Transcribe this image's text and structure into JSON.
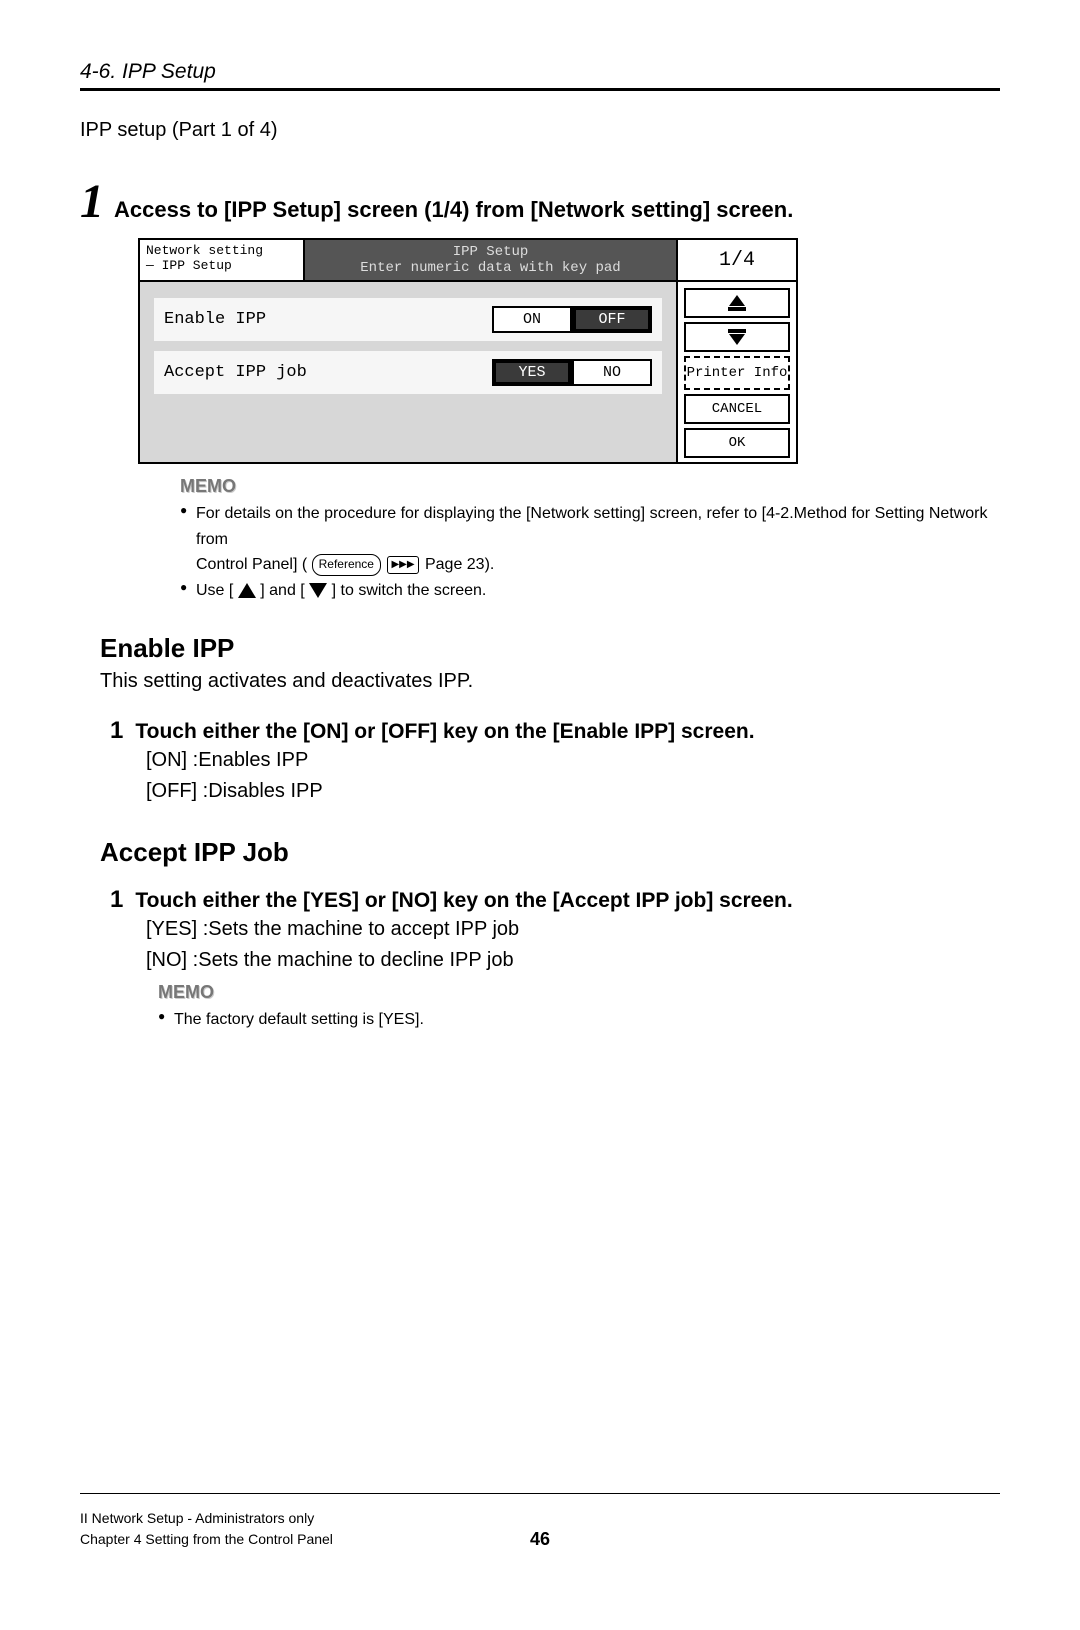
{
  "header": {
    "section_title": "4-6. IPP Setup"
  },
  "intro": "IPP setup (Part 1 of 4)",
  "step1": {
    "num": "1",
    "title": "Access to [IPP Setup] screen (1/4) from [Network setting] screen."
  },
  "panel": {
    "top_left_line1": "Network setting",
    "top_left_line2": "— IPP Setup",
    "top_mid_line1": "IPP Setup",
    "top_mid_line2": "Enter numeric data with key pad",
    "page_indicator": "1/4",
    "row1": {
      "label": "Enable IPP",
      "opt_on": "ON",
      "opt_off": "OFF"
    },
    "row2": {
      "label": "Accept IPP job",
      "opt_yes": "YES",
      "opt_no": "NO"
    },
    "side": {
      "printer_info": "Printer Info",
      "cancel": "CANCEL",
      "ok": "OK"
    }
  },
  "memo1": {
    "label": "MEMO",
    "line1a": "For details on the procedure for displaying the [Network setting] screen, refer to [4-2.Method for Setting Network from",
    "line1b": "Control Panel] ( ",
    "ref_text": "Reference",
    "dots": "▶▶▶",
    "page_ref": " Page 23).",
    "line2a": "Use [",
    "line2b": "] and [",
    "line2c": "] to switch the screen."
  },
  "enable": {
    "heading": "Enable IPP",
    "desc": "This setting activates and deactivates IPP.",
    "sub_num": "1",
    "sub_title": "Touch either the [ON] or [OFF] key on the [Enable IPP] screen.",
    "l1": "[ON]   :Enables IPP",
    "l2": "[OFF] :Disables IPP"
  },
  "accept": {
    "heading": "Accept IPP Job",
    "sub_num": "1",
    "sub_title": "Touch either the [YES] or [NO] key on the [Accept IPP job] screen.",
    "l1": "[YES] :Sets the machine to accept IPP job",
    "l2": "[NO]   :Sets the machine to decline IPP job",
    "memo_label": "MEMO",
    "memo_text": "The factory default setting is [YES]."
  },
  "footer": {
    "left_line1": "II Network Setup - Administrators only",
    "left_line2": "Chapter 4 Setting from the Control Panel",
    "page": "46"
  }
}
